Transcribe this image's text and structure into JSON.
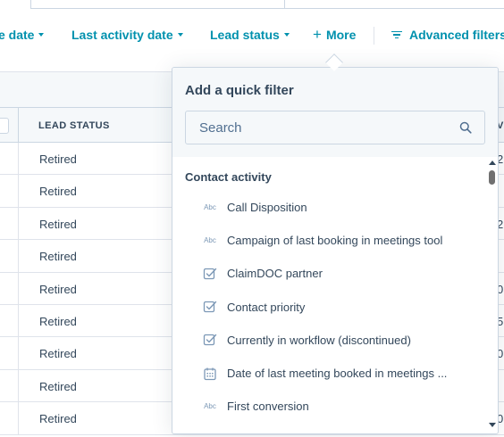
{
  "toolbar": {
    "create_date_label": "e date",
    "last_activity_label": "Last activity date",
    "lead_status_label": "Lead status",
    "more_label": "More",
    "advanced_filters_label": "Advanced filters"
  },
  "table": {
    "column_header": "LEAD STATUS",
    "right_column_header_partial": "V",
    "rows": [
      {
        "lead_status": "Retired",
        "right_partial": "2"
      },
      {
        "lead_status": "Retired",
        "right_partial": ""
      },
      {
        "lead_status": "Retired",
        "right_partial": "2"
      },
      {
        "lead_status": "Retired",
        "right_partial": ""
      },
      {
        "lead_status": "Retired",
        "right_partial": "0"
      },
      {
        "lead_status": "Retired",
        "right_partial": "5"
      },
      {
        "lead_status": "Retired",
        "right_partial": "0"
      },
      {
        "lead_status": "Retired",
        "right_partial": ""
      },
      {
        "lead_status": "Retired",
        "right_partial": "0"
      }
    ]
  },
  "popover": {
    "title": "Add a quick filter",
    "search_placeholder": "Search",
    "section_title": "Contact activity",
    "items": [
      {
        "label": "Call Disposition",
        "icon": "abc-text-icon",
        "icon_text": "Abc"
      },
      {
        "label": "Campaign of last booking in meetings tool",
        "icon": "abc-text-icon",
        "icon_text": "Abc"
      },
      {
        "label": "ClaimDOC partner",
        "icon": "checkbox-icon",
        "icon_text": ""
      },
      {
        "label": "Contact priority",
        "icon": "checkbox-icon",
        "icon_text": ""
      },
      {
        "label": "Currently in workflow (discontinued)",
        "icon": "checkbox-icon",
        "icon_text": ""
      },
      {
        "label": "Date of last meeting booked in meetings ...",
        "icon": "calendar-icon",
        "icon_text": ""
      },
      {
        "label": "First conversion",
        "icon": "abc-text-icon",
        "icon_text": "Abc"
      }
    ]
  },
  "colors": {
    "link": "#0091ae",
    "text": "#33475b",
    "border": "#cbd6e2",
    "header_bg": "#f5f8fa"
  }
}
